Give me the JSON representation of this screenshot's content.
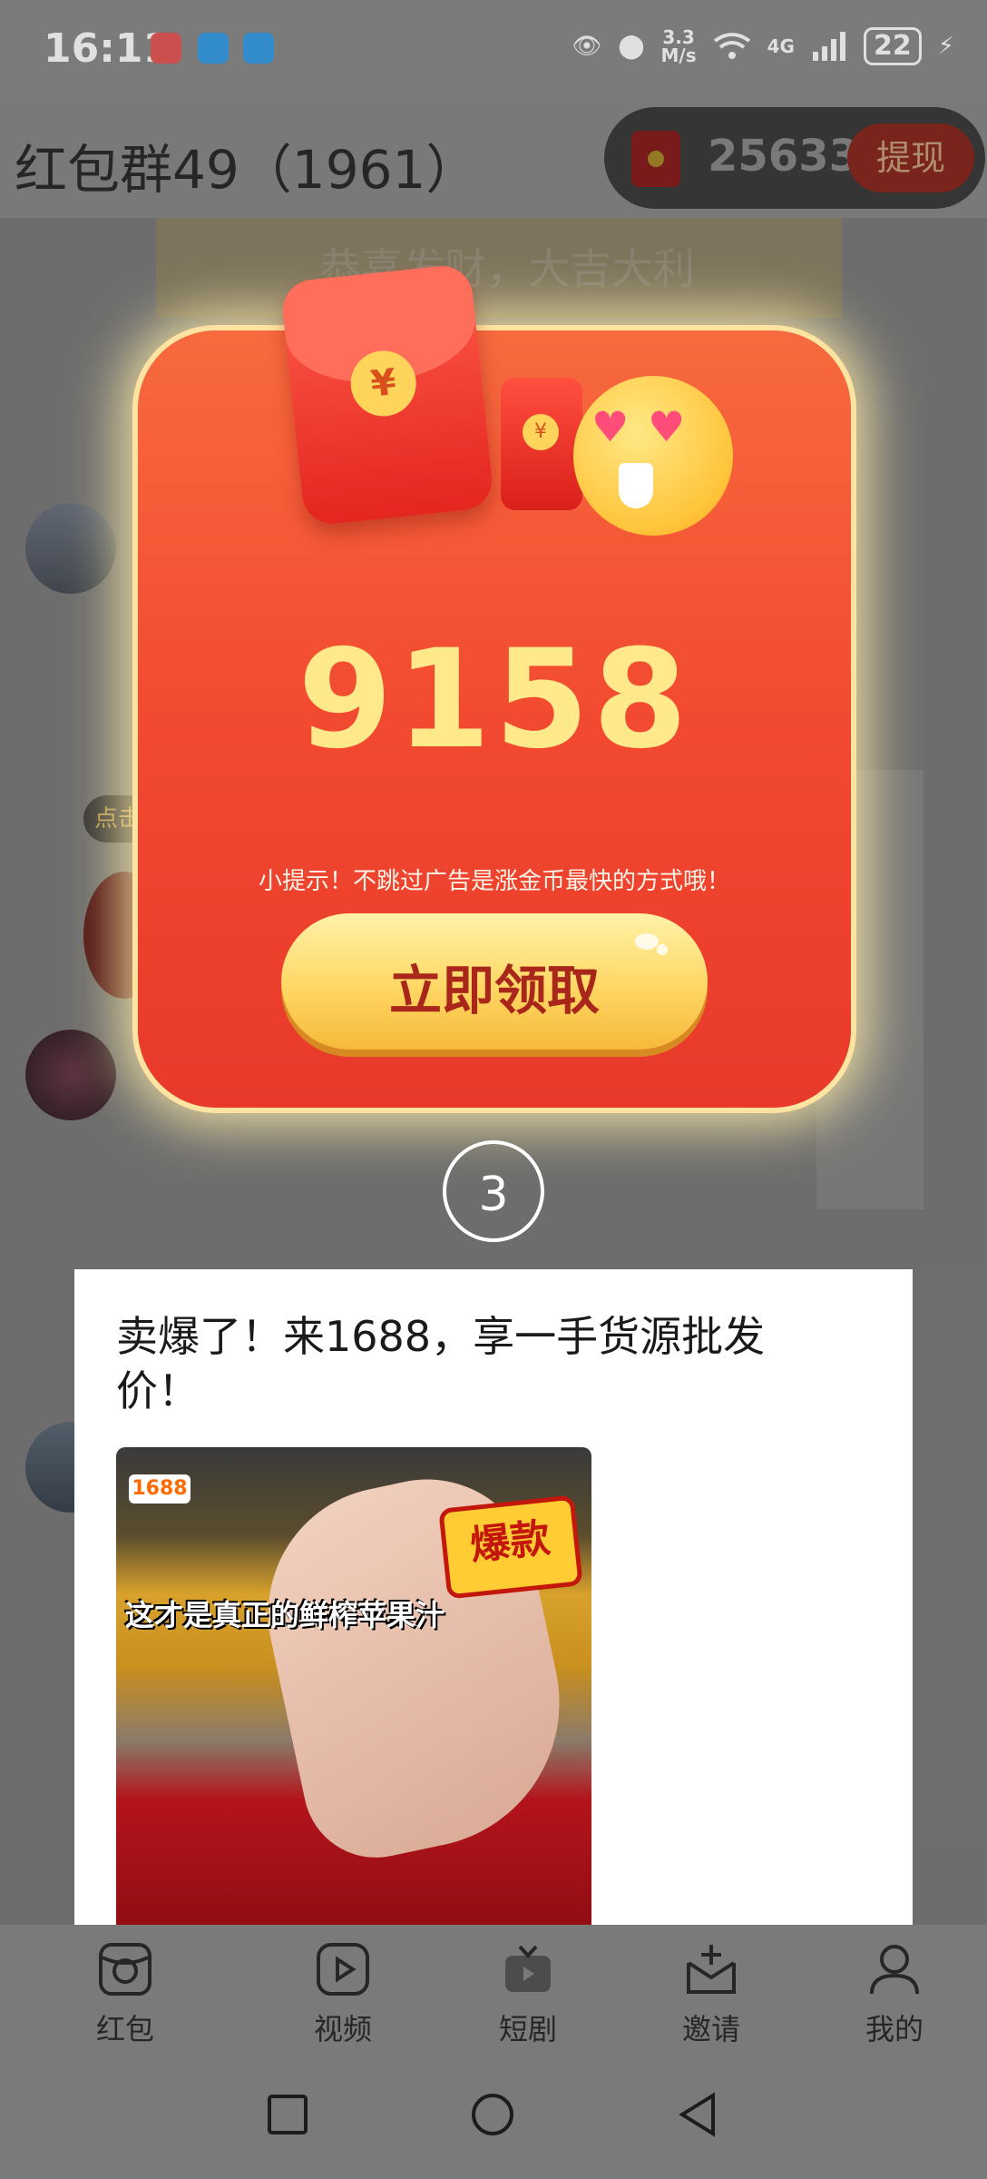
{
  "status_bar": {
    "time": "16:11",
    "speed_value": "3.3",
    "speed_unit": "M/s",
    "network": "4G",
    "battery": "22"
  },
  "header": {
    "title": "红包群49（1961）",
    "coin_balance": "25633",
    "withdraw_label": "提现"
  },
  "chat": {
    "bubble_text": "恭喜发财，大吉大利",
    "click_badge": "点击"
  },
  "popup": {
    "amount": "9158",
    "tip": "小提示！不跳过广告是涨金币最快的方式哦！",
    "claim_label": "立即领取",
    "countdown": "3"
  },
  "ad": {
    "title": "卖爆了！来1688，享一手货源批发价！",
    "image_tag": "1688",
    "image_badge": "爆款",
    "image_caption": "这才是真正的鲜榨苹果汁"
  },
  "bottom_nav": [
    {
      "label": "红包",
      "icon": "red-packet-icon"
    },
    {
      "label": "视频",
      "icon": "video-icon"
    },
    {
      "label": "短剧",
      "icon": "tv-icon"
    },
    {
      "label": "邀请",
      "icon": "invite-icon"
    },
    {
      "label": "我的",
      "icon": "user-icon"
    }
  ],
  "colors": {
    "popup_red": "#f24a30",
    "amount_yellow": "#ffe98a",
    "button_yellow": "#ffd764",
    "button_text": "#a8271a"
  }
}
